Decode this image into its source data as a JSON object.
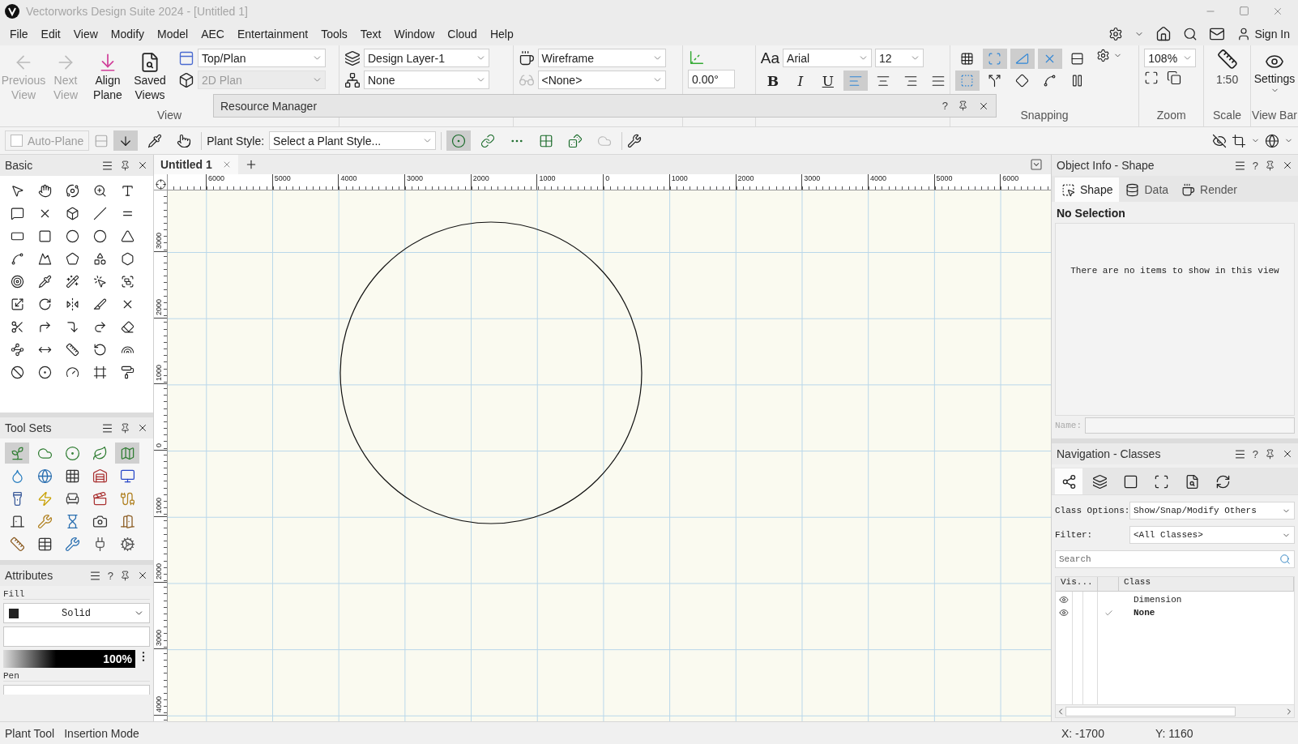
{
  "window": {
    "title": "Vectorworks Design Suite 2024 - [Untitled 1]"
  },
  "menu": [
    "File",
    "Edit",
    "View",
    "Modify",
    "Model",
    "AEC",
    "Entertainment",
    "Tools",
    "Text",
    "Window",
    "Cloud",
    "Help"
  ],
  "account": {
    "sign_in": "Sign In"
  },
  "ribbon": {
    "view": {
      "group": "View",
      "buttons": [
        {
          "label": "Previous View",
          "disabled": true
        },
        {
          "label": "Next View",
          "disabled": true
        },
        {
          "label": "Align Plane",
          "disabled": false
        },
        {
          "label": "Saved Views",
          "disabled": false
        }
      ],
      "view_select": {
        "value": "Top/Plan",
        "disabled": false
      },
      "plane_select": {
        "value": "2D Plan",
        "disabled": true
      }
    },
    "layers": {
      "layer": "Design Layer-1",
      "class": "None"
    },
    "visualization": {
      "render": "Wireframe",
      "light": "<None>"
    },
    "plan_rotation": {
      "value": "0.00°"
    },
    "text": {
      "font_menu": "Aa",
      "font": "Arial",
      "size": "12",
      "styles": [
        "B",
        "I",
        "U"
      ],
      "alignments": [
        {
          "selected": true
        },
        {
          "selected": false
        },
        {
          "selected": false
        },
        {
          "selected": false
        }
      ]
    },
    "snapping": {
      "group": "Snapping",
      "buttons": [
        {
          "selected": false
        },
        {
          "selected": true
        },
        {
          "selected": true
        },
        {
          "selected": true
        },
        {
          "selected": false
        },
        {
          "selected": true
        },
        {
          "selected": false
        },
        {
          "selected": false
        },
        {
          "selected": false
        },
        {
          "selected": false
        }
      ]
    },
    "zoom": {
      "group": "Zoom",
      "value": "108%"
    },
    "scale": {
      "group": "Scale",
      "value": "1:50"
    },
    "view_bar": {
      "group": "View Bar",
      "label": "Settings"
    }
  },
  "resource_manager": {
    "title": "Resource Manager",
    "help": "?"
  },
  "mode_bar": {
    "auto_plane": {
      "label": "Auto-Plane",
      "checked": false
    },
    "plant_style_label": "Plant Style:",
    "plant_style": "Select a Plant Style...",
    "modes": [
      {
        "selected": true
      },
      {
        "selected": false
      },
      {
        "selected": false
      },
      {
        "selected": true
      },
      {
        "selected": false
      },
      {
        "selected": false
      },
      {
        "selected": false
      },
      {
        "selected": false
      },
      {
        "selected": false
      }
    ]
  },
  "basic_palette": {
    "title": "Basic"
  },
  "tool_sets": {
    "title": "Tool Sets",
    "items": [
      {
        "selected": true
      },
      {
        "selected": false
      },
      {
        "selected": false
      },
      {
        "selected": false
      },
      {
        "selected": true
      },
      {
        "selected": false
      },
      {
        "selected": false
      },
      {
        "selected": false
      },
      {
        "selected": false
      },
      {
        "selected": false
      },
      {
        "selected": false
      },
      {
        "selected": false
      },
      {
        "selected": false
      },
      {
        "selected": false
      },
      {
        "selected": false
      },
      {
        "selected": false
      },
      {
        "selected": false
      },
      {
        "selected": false
      },
      {
        "selected": false
      },
      {
        "selected": false
      },
      {
        "selected": false
      },
      {
        "selected": false
      },
      {
        "selected": false
      },
      {
        "selected": false
      },
      {
        "selected": false
      }
    ]
  },
  "attributes": {
    "title": "Attributes",
    "help": "?",
    "fill_label": "Fill",
    "fill_style": "Solid",
    "opacity": "100%",
    "pen_label": "Pen"
  },
  "document_tabs": [
    {
      "label": "Untitled 1",
      "selected": true
    }
  ],
  "canvas": {
    "top_ruler": [
      "6000",
      "5000",
      "4000",
      "3000",
      "2000",
      "1000",
      "0",
      "1000",
      "2000",
      "3000",
      "4000",
      "5000",
      "6000"
    ],
    "left_ruler": [
      "3000",
      "2000",
      "1000",
      "0",
      "1000",
      "2000",
      "3000",
      "4000"
    ]
  },
  "object_info": {
    "title": "Object Info - Shape",
    "help": "?",
    "tabs": [
      {
        "label": "Shape",
        "selected": true
      },
      {
        "label": "Data",
        "selected": false
      },
      {
        "label": "Render",
        "selected": false
      }
    ],
    "selection": "No Selection",
    "empty_message": "There are no items to show in this view",
    "name_label": "Name:"
  },
  "navigation": {
    "title": "Navigation - Classes",
    "help": "?",
    "tabs": [
      {
        "selected": true
      },
      {
        "selected": false
      },
      {
        "selected": false
      },
      {
        "selected": false
      },
      {
        "selected": false
      },
      {
        "selected": false
      }
    ],
    "class_options_label": "Class Options:",
    "class_options": "Show/Snap/Modify Others",
    "filter_label": "Filter:",
    "filter": "<All Classes>",
    "search_placeholder": "Search",
    "columns": [
      "Vis...",
      "Class"
    ],
    "rows": [
      {
        "name": "Dimension",
        "visible": true,
        "active": false
      },
      {
        "name": "None",
        "visible": true,
        "active": true
      }
    ]
  },
  "status_bar": {
    "tool": "Plant Tool",
    "mode": "Insertion Mode",
    "x": "X: -1700",
    "y": "Y: 1160"
  }
}
